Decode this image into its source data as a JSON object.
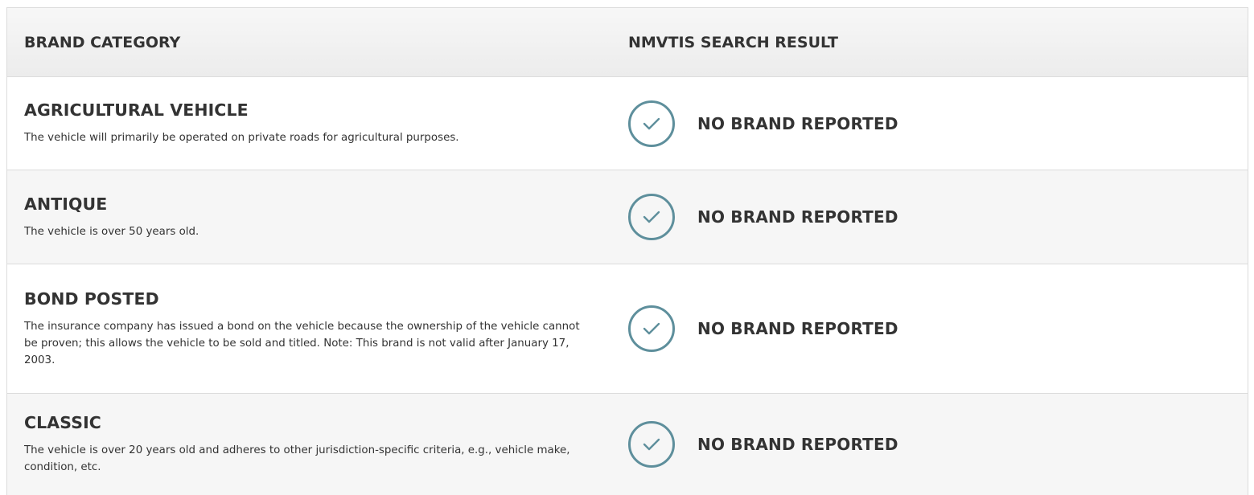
{
  "header": {
    "category_label": "BRAND CATEGORY",
    "result_label": "NMVTIS SEARCH RESULT"
  },
  "rows": [
    {
      "title": "AGRICULTURAL VEHICLE",
      "description": "The vehicle will primarily be operated on private roads for agricultural purposes.",
      "result": "NO BRAND REPORTED",
      "icon": "check-circle-icon"
    },
    {
      "title": "ANTIQUE",
      "description": "The vehicle is over 50 years old.",
      "result": "NO BRAND REPORTED",
      "icon": "check-circle-icon"
    },
    {
      "title": "BOND POSTED",
      "description": "The insurance company has issued a bond on the vehicle because the ownership of the vehicle cannot be proven; this allows the vehicle to be sold and titled. Note: This brand is not valid after January 17, 2003.",
      "result": "NO BRAND REPORTED",
      "icon": "check-circle-icon"
    },
    {
      "title": "CLASSIC",
      "description": "The vehicle is over 20 years old and adheres to other jurisdiction-specific criteria, e.g., vehicle make, condition, etc.",
      "result": "NO BRAND REPORTED",
      "icon": "check-circle-icon"
    }
  ],
  "colors": {
    "check_accent": "#5e8f9c",
    "header_bg": "#efefef",
    "alt_row_bg": "#f6f6f6",
    "text": "#333333"
  }
}
